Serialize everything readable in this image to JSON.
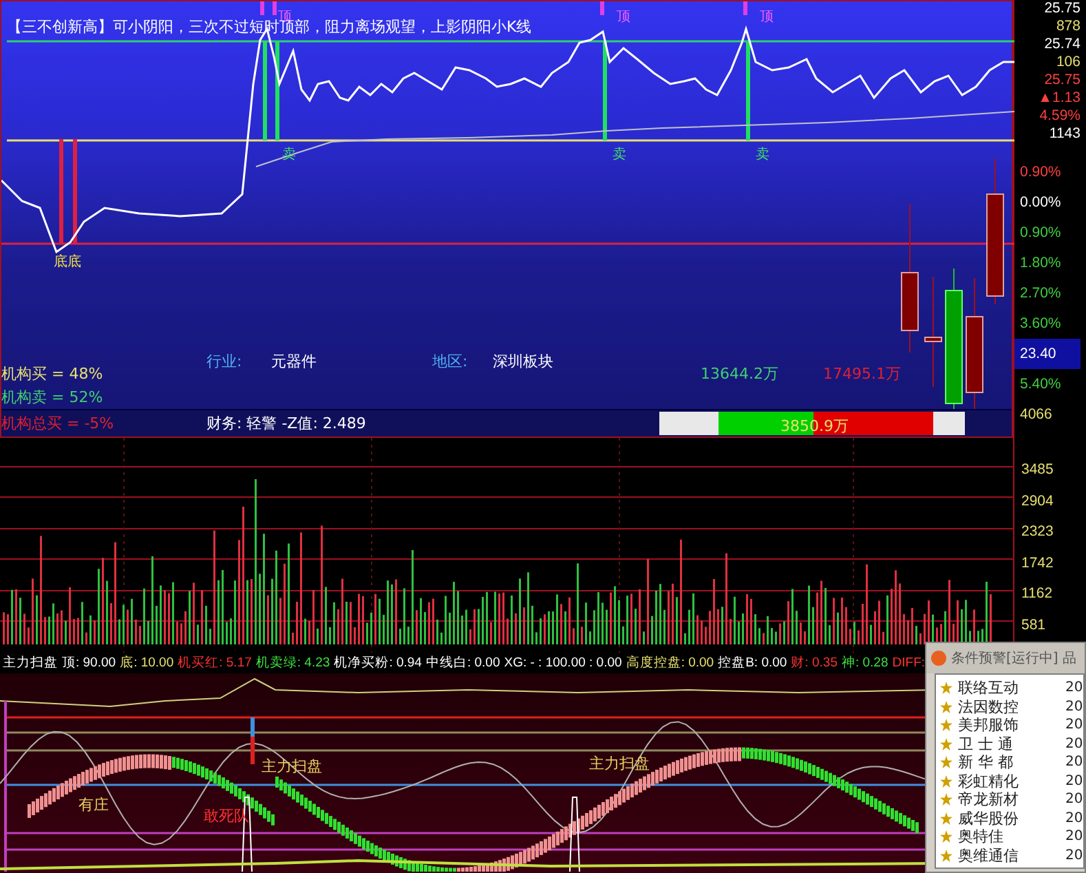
{
  "price_panel": {
    "caption": "【三不创新高】可小阴阳，三次不过短时顶部，阻力离场观望，上影阴阳小K线",
    "markers": [
      {
        "text": "顶",
        "kind": "top"
      },
      {
        "text": "顶",
        "kind": "top"
      },
      {
        "text": "顶",
        "kind": "top"
      },
      {
        "text": "卖",
        "kind": "sell"
      },
      {
        "text": "卖",
        "kind": "sell"
      },
      {
        "text": "卖",
        "kind": "sell"
      },
      {
        "text": "底底",
        "kind": "bottom"
      }
    ],
    "info": {
      "industry_label": "行业:",
      "industry": "元器件",
      "region_label": "地区:",
      "region": "深圳板块",
      "inst_buy": "机构买 = 48%",
      "inst_sell": "机构卖 = 52%",
      "inst_total": "机构总买 = -5%",
      "finance": "财务: 轻警   -Z值: 2.489"
    },
    "flow": {
      "inflow": "13644.2万",
      "outflow": "17495.1万",
      "net": "3850.9万",
      "level": 0.44
    }
  },
  "price_axis": [
    {
      "text": "25.75",
      "color": "#ffffff"
    },
    {
      "text": "878",
      "color": "#e8e070"
    },
    {
      "text": "25.74",
      "color": "#ffffff"
    },
    {
      "text": "106",
      "color": "#e8e070"
    },
    {
      "text": "25.75",
      "color": "#ff4040"
    },
    {
      "text": "▲1.13",
      "color": "#ff4040"
    },
    {
      "text": "4.59%",
      "color": "#ff4040"
    },
    {
      "text": "1143",
      "color": "#ffffff"
    }
  ],
  "percent_axis": [
    {
      "text": "0.90%",
      "color": "#ff4040",
      "kind": "tick"
    },
    {
      "text": "0.00%",
      "color": "#ffffff",
      "kind": "tick"
    },
    {
      "text": "0.90%",
      "color": "#40d040",
      "kind": "tick"
    },
    {
      "text": "1.80%",
      "color": "#40d040",
      "kind": "tick"
    },
    {
      "text": "2.70%",
      "color": "#40d040",
      "kind": "tick"
    },
    {
      "text": "3.60%",
      "color": "#40d040",
      "kind": "tick"
    },
    {
      "text": "23.40",
      "kind": "cursor"
    },
    {
      "text": "5.40%",
      "color": "#40d040",
      "kind": "tick"
    },
    {
      "text": "4066",
      "color": "#e8e070",
      "kind": "tick"
    }
  ],
  "volume_axis": [
    "3485",
    "2904",
    "2323",
    "1742",
    "1162",
    "581"
  ],
  "indicator": {
    "header": [
      {
        "text": "主力扫盘",
        "color": "#ffffff"
      },
      {
        "text": "顶: 90.00",
        "color": "#ffffff"
      },
      {
        "text": "底: 10.00",
        "color": "#e8e070"
      },
      {
        "text": "机买红: 5.17",
        "color": "#ff3030"
      },
      {
        "text": "机卖绿: 4.23",
        "color": "#40e040"
      },
      {
        "text": "机净买粉: 0.94",
        "color": "#ffffff"
      },
      {
        "text": "中线白: 0.00",
        "color": "#ffffff"
      },
      {
        "text": "XG: - : 100.00 : 0.00",
        "color": "#ffffff"
      },
      {
        "text": "高度控盘: 0.00",
        "color": "#e8e070"
      },
      {
        "text": "控盘B: 0.00",
        "color": "#ffffff"
      },
      {
        "text": "财: 0.35",
        "color": "#ff3030"
      },
      {
        "text": "神: 0.28",
        "color": "#40e040"
      },
      {
        "text": "DIFF:",
        "color": "#ff3030"
      }
    ],
    "labels": [
      {
        "text": "有庄",
        "color": "#e8d060"
      },
      {
        "text": "主力扫盘",
        "color": "#e8d060"
      },
      {
        "text": "敢死队",
        "color": "#ff3030"
      },
      {
        "text": "主力扫盘",
        "color": "#e8d060"
      }
    ]
  },
  "alert_window": {
    "title": "条件预警[运行中] 品",
    "items": [
      {
        "name": "联络互动",
        "column_2": "20"
      },
      {
        "name": "法因数控",
        "column_2": "20"
      },
      {
        "name": "美邦服饰",
        "column_2": "20"
      },
      {
        "name": "卫 士 通",
        "column_2": "20"
      },
      {
        "name": "新 华 都",
        "column_2": "20"
      },
      {
        "name": "彩虹精化",
        "column_2": "20"
      },
      {
        "name": "帝龙新材",
        "column_2": "20"
      },
      {
        "name": "威华股份",
        "column_2": "20"
      },
      {
        "name": "奥特佳",
        "column_2": "20"
      },
      {
        "name": "奥维通信",
        "column_2": "20"
      }
    ]
  }
}
